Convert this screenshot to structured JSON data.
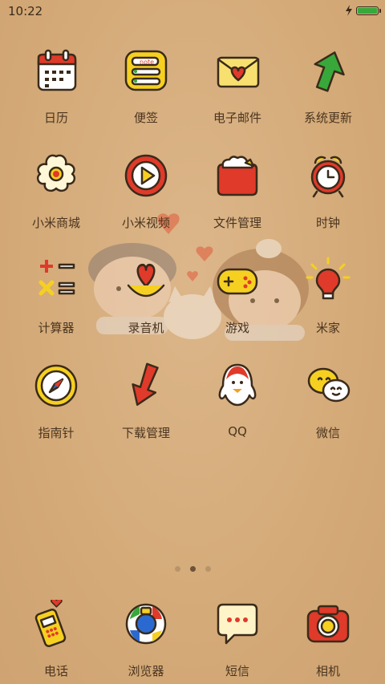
{
  "status_bar": {
    "time": "10:22",
    "battery_level": 1.0,
    "charging": true
  },
  "apps": [
    {
      "name": "calendar",
      "label": "日历"
    },
    {
      "name": "notes",
      "label": "便签",
      "badge_text": "note"
    },
    {
      "name": "email",
      "label": "电子邮件"
    },
    {
      "name": "system-update",
      "label": "系统更新"
    },
    {
      "name": "mi-store",
      "label": "小米商城"
    },
    {
      "name": "mi-video",
      "label": "小米视频"
    },
    {
      "name": "file-manager",
      "label": "文件管理"
    },
    {
      "name": "clock",
      "label": "时钟"
    },
    {
      "name": "calculator",
      "label": "计算器"
    },
    {
      "name": "recorder",
      "label": "录音机"
    },
    {
      "name": "games",
      "label": "游戏"
    },
    {
      "name": "mi-home",
      "label": "米家"
    },
    {
      "name": "compass",
      "label": "指南针"
    },
    {
      "name": "downloads",
      "label": "下载管理"
    },
    {
      "name": "qq",
      "label": "QQ"
    },
    {
      "name": "wechat",
      "label": "微信"
    }
  ],
  "pager": {
    "pages": 3,
    "current": 2
  },
  "dock": [
    {
      "name": "phone",
      "label": "电话"
    },
    {
      "name": "browser",
      "label": "浏览器"
    },
    {
      "name": "messages",
      "label": "短信"
    },
    {
      "name": "camera",
      "label": "相机"
    }
  ],
  "colors": {
    "label": "#4a3520",
    "background": "#d4aa78",
    "accent_red": "#e03a2a",
    "accent_yellow": "#f5d020"
  }
}
